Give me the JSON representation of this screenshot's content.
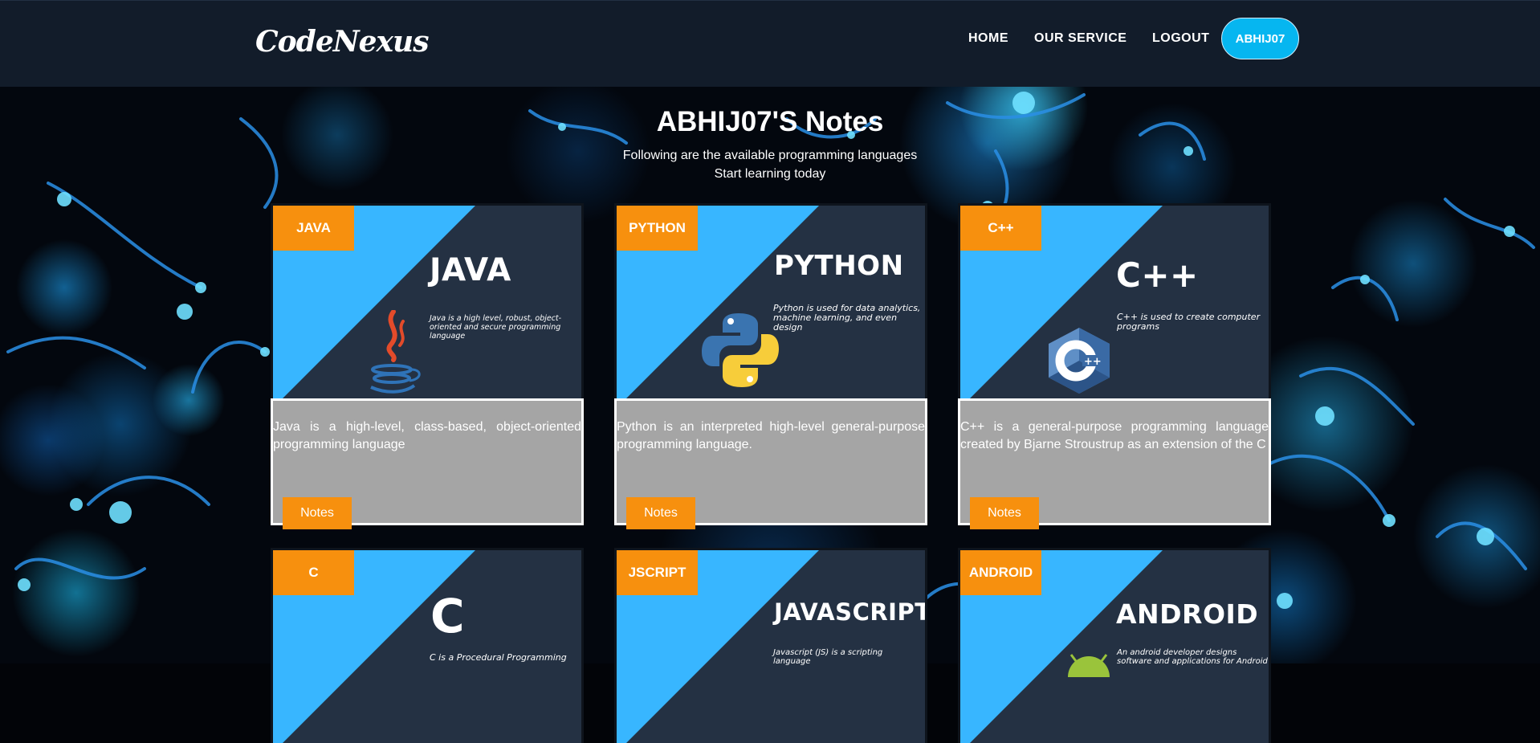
{
  "navbar": {
    "brand": "CodeNexus",
    "links": [
      "HOME",
      "OUR SERVICE",
      "LOGOUT"
    ],
    "user_button": "ABHIJ07"
  },
  "header": {
    "title": "ABHIJ07'S Notes",
    "subtitle_line1": "Following are the available programming languages",
    "subtitle_line2": "Start learning today"
  },
  "cards": [
    {
      "badge": "JAVA",
      "image_title": "JAVA",
      "image_tagline": "Java is a high level, robust, object-oriented and secure programming language",
      "description": "Java is a high-level, class-based, object-oriented programming language",
      "button": "Notes",
      "icon": "java-cup-icon"
    },
    {
      "badge": "PYTHON",
      "image_title": "PYTHON",
      "image_tagline": "Python is used for data analytics, machine learning, and even design",
      "description": "Python is an interpreted high-level general-purpose programming language.",
      "button": "Notes",
      "icon": "python-logo-icon"
    },
    {
      "badge": "C++",
      "image_title": "C++",
      "image_tagline": "C++ is used to create computer programs",
      "description": "C++ is a general-purpose programming language created by Bjarne Stroustrup as an extension of the C",
      "button": "Notes",
      "icon": "cpp-logo-icon"
    },
    {
      "badge": "C",
      "image_title": "C",
      "image_tagline": "C is a Procedural Programming",
      "icon": "c-logo-icon"
    },
    {
      "badge": "JSCRIPT",
      "image_title": "JAVASCRIPT",
      "image_tagline": "Javascript (JS) is a scripting language",
      "icon": "javascript-logo-icon"
    },
    {
      "badge": "ANDROID",
      "image_title": "ANDROID",
      "image_tagline": "An android developer designs software and applications for Android",
      "icon": "android-logo-icon"
    }
  ],
  "colors": {
    "navbar_bg": "#121c2a",
    "accent_orange": "#f7900e",
    "accent_blue": "#38b6ff",
    "user_button": "#06b6f0",
    "card_body": "#a5a5a5",
    "card_image_dark": "#243143"
  }
}
